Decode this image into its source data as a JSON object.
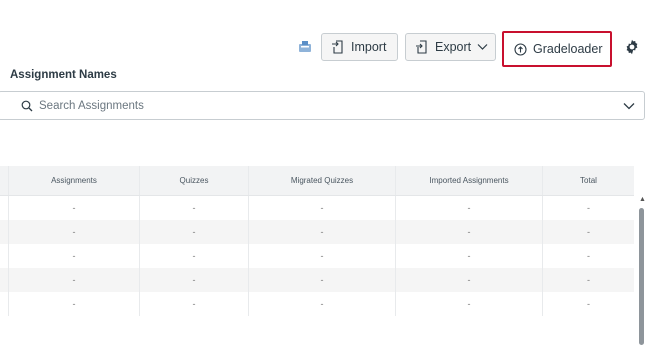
{
  "toolbar": {
    "import_label": "Import",
    "export_label": "Export",
    "gradeloader_label": "Gradeloader",
    "settings_icon": "gear-icon",
    "highlight_color": "#c8102e"
  },
  "assignment_filter": {
    "label": "Assignment Names",
    "placeholder": "Search Assignments"
  },
  "table": {
    "headers": [
      "Assignments",
      "Quizzes",
      "Migrated Quizzes",
      "Imported Assignments",
      "Total"
    ],
    "rows": [
      [
        "-",
        "-",
        "-",
        "-",
        "-"
      ],
      [
        "-",
        "-",
        "-",
        "-",
        "-"
      ],
      [
        "-",
        "-",
        "-",
        "-",
        "-"
      ],
      [
        "-",
        "-",
        "-",
        "-",
        "-"
      ],
      [
        "-",
        "-",
        "-",
        "-",
        "-"
      ]
    ]
  }
}
